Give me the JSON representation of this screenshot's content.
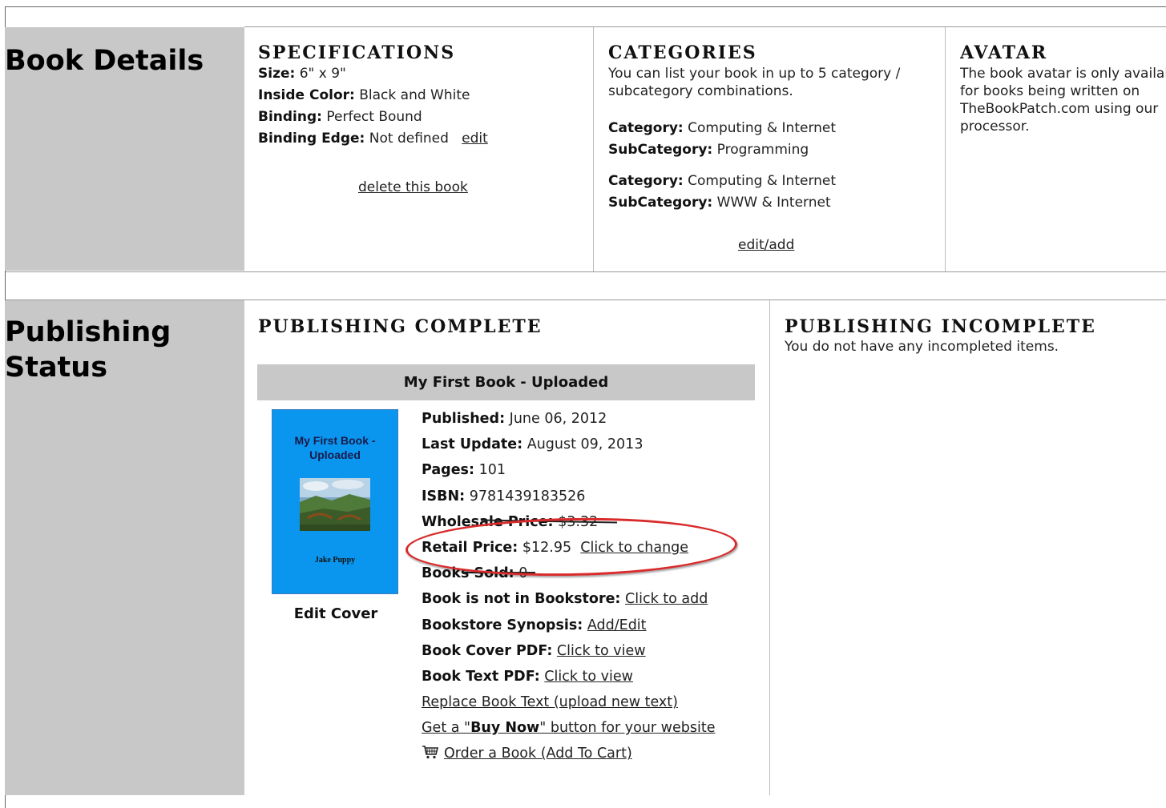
{
  "book_details": {
    "section_title": "Book Details",
    "specifications": {
      "heading": "SPECIFICATIONS",
      "size_label": "Size:",
      "size_value": "6\" x 9\"",
      "inside_color_label": "Inside Color:",
      "inside_color_value": "Black and White",
      "binding_label": "Binding:",
      "binding_value": "Perfect Bound",
      "binding_edge_label": "Binding Edge:",
      "binding_edge_value": "Not defined",
      "edit_link": "edit",
      "delete_link": "delete this book"
    },
    "categories": {
      "heading": "CATEGORIES",
      "intro": "You can list your book in up to 5 category / subcategory combinations.",
      "category_label": "Category:",
      "subcategory_label": "SubCategory:",
      "entries": [
        {
          "category": "Computing & Internet",
          "subcategory": "Programming"
        },
        {
          "category": "Computing & Internet",
          "subcategory": "WWW & Internet"
        }
      ],
      "edit_add_link": "edit/add"
    },
    "avatar": {
      "heading": "AVATAR",
      "text": "The book avatar is only available for books being written on TheBookPatch.com using our processor."
    }
  },
  "publishing_status": {
    "section_title": "Publishing Status",
    "complete": {
      "heading": "PUBLISHING COMPLETE",
      "book_title": "My First Book - Uploaded",
      "cover": {
        "title": "My First Book - Uploaded",
        "author": "Jake Puppy",
        "edit_label": "Edit Cover"
      },
      "published_label": "Published:",
      "published_value": "June 06, 2012",
      "last_update_label": "Last Update:",
      "last_update_value": "August 09, 2013",
      "pages_label": "Pages:",
      "pages_value": "101",
      "isbn_label": "ISBN:",
      "isbn_value": "9781439183526",
      "wholesale_label": "Wholesale Price:",
      "wholesale_value": "$3.32",
      "retail_label": "Retail Price:",
      "retail_value": "$12.95",
      "retail_link": "Click to change",
      "sold_label": "Books Sold:",
      "sold_value": "0",
      "bookstore_label": "Book is not in Bookstore:",
      "bookstore_link": "Click to add",
      "synopsis_label": "Bookstore Synopsis:",
      "synopsis_link": "Add/Edit",
      "cover_pdf_label": "Book Cover PDF:",
      "cover_pdf_link": "Click to view",
      "text_pdf_label": "Book Text PDF:",
      "text_pdf_link": "Click to view",
      "replace_text_link": "Replace Book Text (upload new text)",
      "buy_now_pre": "Get a \"",
      "buy_now_bold": "Buy Now",
      "buy_now_post": "\" button for your website",
      "order_link": "Order a Book (Add To Cart)"
    },
    "incomplete": {
      "heading": "PUBLISHING INCOMPLETE",
      "text": "You do not have any incompleted items."
    }
  },
  "colors": {
    "sidebar": "#c8c8c8",
    "cover": "#0a96ee",
    "highlight": "#d92b2b"
  }
}
